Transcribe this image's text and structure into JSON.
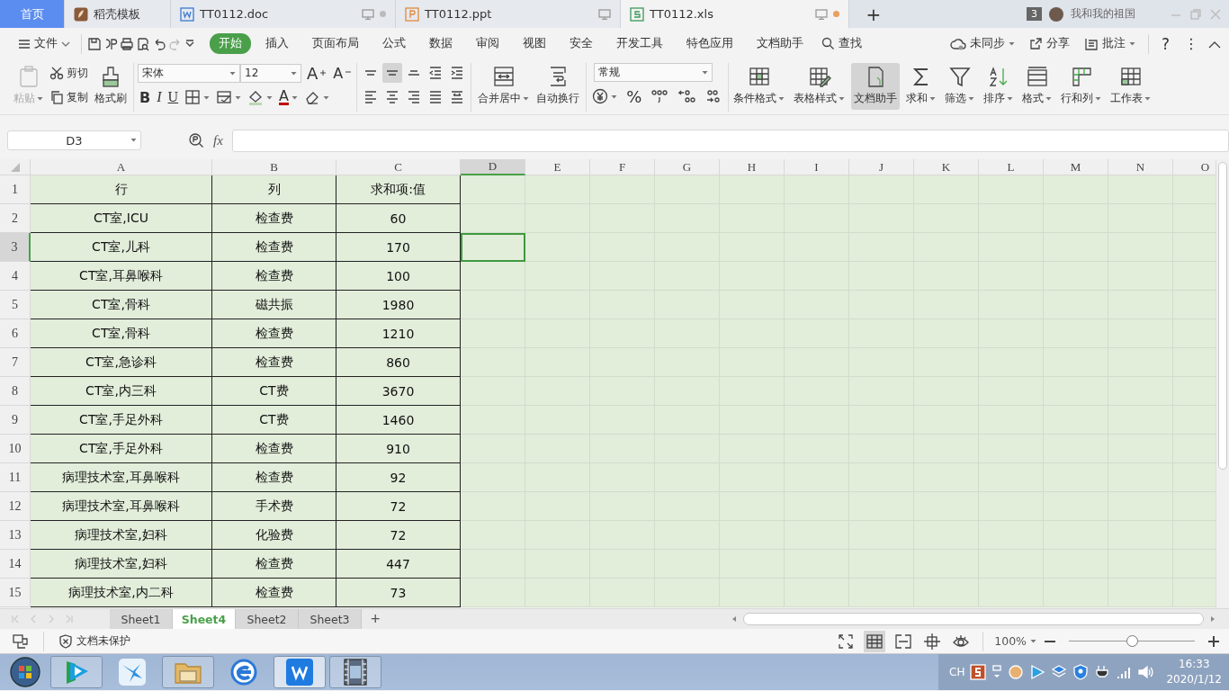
{
  "tabs": [
    {
      "label": "首页",
      "kind": "home",
      "selected": false
    },
    {
      "label": "稻壳模板",
      "kind": "template",
      "selected": false
    },
    {
      "label": "TT0112.doc",
      "kind": "doc",
      "selected": false,
      "unsaved": false
    },
    {
      "label": "TT0112.ppt",
      "kind": "ppt",
      "selected": false
    },
    {
      "label": "TT0112.xls",
      "kind": "xls",
      "selected": true,
      "unsaved": true
    }
  ],
  "new_tab": "+",
  "window_count": "3",
  "user": {
    "name": "我和我的祖国"
  },
  "menu": {
    "file": "文件",
    "tabs": [
      {
        "label": "开始",
        "selected": true
      },
      {
        "label": "插入",
        "selected": false
      },
      {
        "label": "页面布局",
        "selected": false
      },
      {
        "label": "公式",
        "selected": false
      },
      {
        "label": "数据",
        "selected": false
      },
      {
        "label": "审阅",
        "selected": false
      },
      {
        "label": "视图",
        "selected": false
      },
      {
        "label": "安全",
        "selected": false
      },
      {
        "label": "开发工具",
        "selected": false
      },
      {
        "label": "特色应用",
        "selected": false
      },
      {
        "label": "文档助手",
        "selected": false
      }
    ],
    "search": "查找",
    "sync": "未同步",
    "share": "分享",
    "comment": "批注",
    "help": "?",
    "more": "⋮"
  },
  "ribbon": {
    "paste": {
      "label": "粘贴",
      "disabled": true
    },
    "cut": "剪切",
    "copy": "复制",
    "format_painter": "格式刷",
    "font": "宋体",
    "font_size": "12",
    "grow_font": "A",
    "shrink_font": "A",
    "bold": "B",
    "italic": "I",
    "underline": "U",
    "font_color": "A",
    "alignments": [
      {
        "kind": "top",
        "selected": false
      },
      {
        "kind": "middle",
        "selected": true
      },
      {
        "kind": "bottom",
        "selected": false
      },
      {
        "kind": "outdent",
        "selected": false
      },
      {
        "kind": "indent",
        "selected": false
      },
      {
        "kind": "left",
        "selected": false
      },
      {
        "kind": "center",
        "selected": false
      },
      {
        "kind": "right",
        "selected": false
      },
      {
        "kind": "justify",
        "selected": false
      },
      {
        "kind": "distributed",
        "selected": false
      }
    ],
    "merge": "合并居中",
    "wrap": "自动换行",
    "number_format": "常规",
    "percent": "%",
    "large_buttons": [
      {
        "label": "条件格式",
        "kind": "conditional",
        "selected": false,
        "dropdown": true
      },
      {
        "label": "表格样式",
        "kind": "table_style",
        "selected": false,
        "dropdown": true
      },
      {
        "label": "文档助手",
        "kind": "assistant",
        "selected": true,
        "dropdown": false
      },
      {
        "label": "求和",
        "kind": "sum",
        "selected": false,
        "dropdown": true
      },
      {
        "label": "筛选",
        "kind": "filter",
        "selected": false,
        "dropdown": true
      },
      {
        "label": "排序",
        "kind": "sort",
        "selected": false,
        "dropdown": true
      },
      {
        "label": "格式",
        "kind": "format",
        "selected": false,
        "dropdown": true
      },
      {
        "label": "行和列",
        "kind": "rowcol",
        "selected": false,
        "dropdown": true
      },
      {
        "label": "工作表",
        "kind": "sheet",
        "selected": false,
        "dropdown": true
      }
    ]
  },
  "formula_bar": {
    "name_box": "D3",
    "fx": "fx"
  },
  "sheet": {
    "columns": [
      {
        "label": "A",
        "selected": false
      },
      {
        "label": "B",
        "selected": false
      },
      {
        "label": "C",
        "selected": false
      },
      {
        "label": "D",
        "selected": true
      },
      {
        "label": "E",
        "selected": false
      },
      {
        "label": "F",
        "selected": false
      },
      {
        "label": "G",
        "selected": false
      },
      {
        "label": "H",
        "selected": false
      },
      {
        "label": "I",
        "selected": false
      },
      {
        "label": "J",
        "selected": false
      },
      {
        "label": "K",
        "selected": false
      },
      {
        "label": "L",
        "selected": false
      },
      {
        "label": "M",
        "selected": false
      },
      {
        "label": "N",
        "selected": false
      },
      {
        "label": "O",
        "selected": false
      }
    ],
    "rows": [
      {
        "label": "1",
        "selected": false,
        "cells": [
          "行",
          "列",
          "求和项:值"
        ]
      },
      {
        "label": "2",
        "selected": false,
        "cells": [
          "CT室,ICU",
          "检查费",
          "60"
        ]
      },
      {
        "label": "3",
        "selected": true,
        "cells": [
          "CT室,儿科",
          "检查费",
          "170"
        ]
      },
      {
        "label": "4",
        "selected": false,
        "cells": [
          "CT室,耳鼻喉科",
          "检查费",
          "100"
        ]
      },
      {
        "label": "5",
        "selected": false,
        "cells": [
          "CT室,骨科",
          "磁共振",
          "1980"
        ]
      },
      {
        "label": "6",
        "selected": false,
        "cells": [
          "CT室,骨科",
          "检查费",
          "1210"
        ]
      },
      {
        "label": "7",
        "selected": false,
        "cells": [
          "CT室,急诊科",
          "检查费",
          "860"
        ]
      },
      {
        "label": "8",
        "selected": false,
        "cells": [
          "CT室,内三科",
          "CT费",
          "3670"
        ]
      },
      {
        "label": "9",
        "selected": false,
        "cells": [
          "CT室,手足外科",
          "CT费",
          "1460"
        ]
      },
      {
        "label": "10",
        "selected": false,
        "cells": [
          "CT室,手足外科",
          "检查费",
          "910"
        ]
      },
      {
        "label": "11",
        "selected": false,
        "cells": [
          "病理技术室,耳鼻喉科",
          "检查费",
          "92"
        ]
      },
      {
        "label": "12",
        "selected": false,
        "cells": [
          "病理技术室,耳鼻喉科",
          "手术费",
          "72"
        ]
      },
      {
        "label": "13",
        "selected": false,
        "cells": [
          "病理技术室,妇科",
          "化验费",
          "72"
        ]
      },
      {
        "label": "14",
        "selected": false,
        "cells": [
          "病理技术室,妇科",
          "检查费",
          "447"
        ]
      },
      {
        "label": "15",
        "selected": false,
        "cells": [
          "病理技术室,内二科",
          "检查费",
          "73"
        ]
      }
    ]
  },
  "sheet_tabs": [
    {
      "label": "Sheet1",
      "selected": false
    },
    {
      "label": "Sheet4",
      "selected": true
    },
    {
      "label": "Sheet2",
      "selected": false
    },
    {
      "label": "Sheet3",
      "selected": false
    }
  ],
  "add_sheet": "+",
  "status_bar": {
    "protection": "文档未保护",
    "view_buttons": [
      {
        "kind": "fullscreen",
        "selected": false
      },
      {
        "kind": "normal",
        "selected": true
      },
      {
        "kind": "pagebreak",
        "selected": false
      },
      {
        "kind": "reading",
        "selected": false
      },
      {
        "kind": "eye",
        "selected": false
      }
    ],
    "zoom": "100%",
    "zoom_slider": {
      "level": 0.5
    }
  },
  "taskbar": {
    "apps": [
      {
        "kind": "video",
        "running": true,
        "selected": false
      },
      {
        "kind": "bird",
        "running": false,
        "selected": false
      },
      {
        "kind": "folder",
        "running": true,
        "selected": false
      },
      {
        "kind": "browser",
        "running": false,
        "selected": false
      },
      {
        "kind": "wps",
        "running": true,
        "selected": true
      },
      {
        "kind": "film",
        "running": true,
        "selected": false
      }
    ],
    "language": "CH",
    "time": "16:33",
    "date": "2020/1/12"
  }
}
